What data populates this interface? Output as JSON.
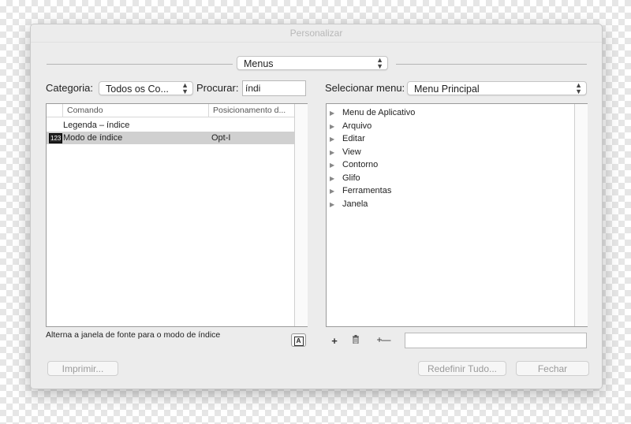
{
  "window": {
    "title": "Personalizar"
  },
  "mode_popup": {
    "value": "Menus"
  },
  "left": {
    "category_label": "Categoria:",
    "category_value": "Todos os Co...",
    "search_label": "Procurar:",
    "search_value": "índi",
    "columns": [
      "Comando",
      "Posicionamento d..."
    ],
    "rows": [
      {
        "command": "Legenda – índice",
        "shortcut": ""
      },
      {
        "command": "Modo de índice",
        "shortcut": "Opt-I",
        "icon": "123"
      }
    ],
    "description": "Alterna a janela de fonte para o modo de índice"
  },
  "right": {
    "menu_label": "Selecionar menu:",
    "menu_value": "Menu Principal",
    "items": [
      "Menu de Aplicativo",
      "Arquivo",
      "Editar",
      "View",
      "Contorno",
      "Glifo",
      "Ferramentas",
      "Janela"
    ]
  },
  "toolbar": {
    "add": "+",
    "separator": "+—"
  },
  "buttons": {
    "print": "Imprimir...",
    "reset": "Redefinir Tudo...",
    "close": "Fechar"
  }
}
